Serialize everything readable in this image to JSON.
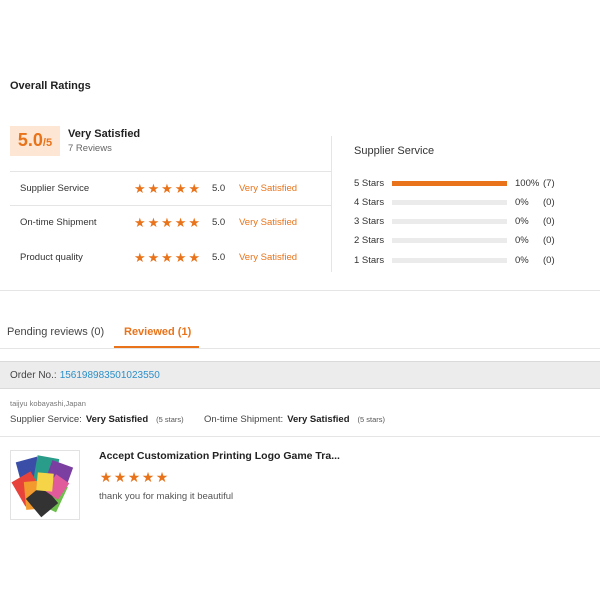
{
  "overall": {
    "title": "Overall Ratings",
    "score_main": "5.0",
    "score_suffix": "/5",
    "satisfaction": "Very Satisfied",
    "reviews": "7 Reviews"
  },
  "ratings": [
    {
      "label": "Supplier Service",
      "stars": 5,
      "value": "5.0",
      "text": "Very Satisfied"
    },
    {
      "label": "On-time Shipment",
      "stars": 5,
      "value": "5.0",
      "text": "Very Satisfied"
    },
    {
      "label": "Product quality",
      "stars": 5,
      "value": "5.0",
      "text": "Very Satisfied"
    }
  ],
  "supplier_service": {
    "title": "Supplier Service",
    "rows": [
      {
        "label": "5 Stars",
        "fraction": 1.0,
        "pct": "100%",
        "count": "(7)"
      },
      {
        "label": "4 Stars",
        "fraction": 0,
        "pct": "0%",
        "count": "(0)"
      },
      {
        "label": "3 Stars",
        "fraction": 0,
        "pct": "0%",
        "count": "(0)"
      },
      {
        "label": "2 Stars",
        "fraction": 0,
        "pct": "0%",
        "count": "(0)"
      },
      {
        "label": "1 Stars",
        "fraction": 0,
        "pct": "0%",
        "count": "(0)"
      }
    ]
  },
  "tabs": {
    "pending": "Pending reviews (0)",
    "reviewed": "Reviewed (1)"
  },
  "order": {
    "label": "Order No.:",
    "number": "156198983501023550"
  },
  "review": {
    "reviewer": "taijyu kobayashi,Japan",
    "supplier_label": "Supplier Service:",
    "supplier_value": "Very Satisfied",
    "supplier_stars": "(5 stars)",
    "shipment_label": "On-time Shipment:",
    "shipment_value": "Very Satisfied",
    "shipment_stars": "(5 stars)",
    "product_title": "Accept Customization Printing Logo Game Tra...",
    "product_stars": 5,
    "comment": "thank you for making it beautiful"
  },
  "colors": {
    "accent": "#e8731a",
    "link": "#2b8fc9",
    "score_bg": "#fde6d3"
  }
}
